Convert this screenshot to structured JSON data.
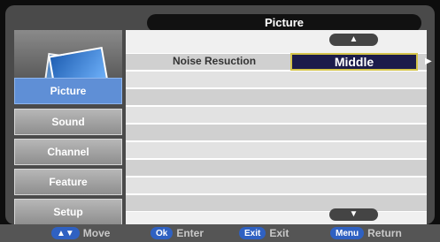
{
  "header": {
    "title": "Picture"
  },
  "sidebar": {
    "items": [
      {
        "label": "Picture"
      },
      {
        "label": "Sound"
      },
      {
        "label": "Channel"
      },
      {
        "label": "Feature"
      },
      {
        "label": "Setup"
      }
    ]
  },
  "main": {
    "setting_label": "Noise Resuction",
    "setting_value": "Middle"
  },
  "footer": {
    "hints": [
      {
        "key": "▲▼",
        "label": "Move"
      },
      {
        "key": "Ok",
        "label": "Enter"
      },
      {
        "key": "Exit",
        "label": "Exit"
      },
      {
        "key": "Menu",
        "label": "Return"
      }
    ]
  }
}
